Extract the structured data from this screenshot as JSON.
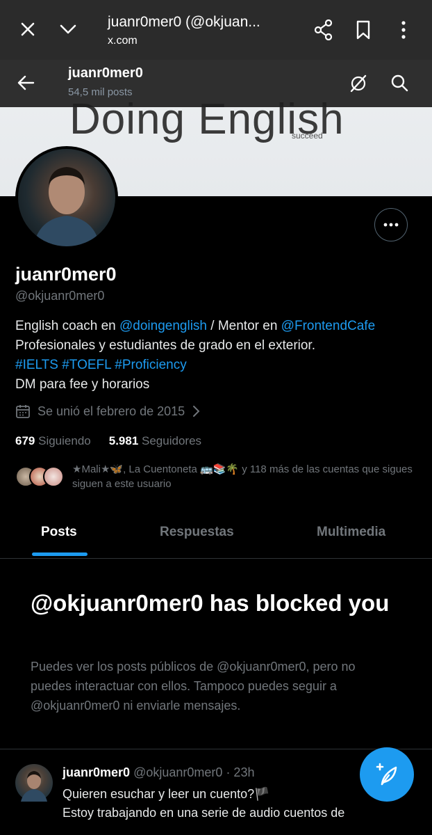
{
  "browser": {
    "title": "juanr0mer0 (@okjuan...",
    "url": "x.com",
    "icons": [
      "close-icon",
      "chevron-down-icon",
      "share-icon",
      "bookmark-icon",
      "more-vert-icon"
    ]
  },
  "banner": {
    "text": "Doing English",
    "subtext": "succeed"
  },
  "topbar": {
    "name": "juanr0mer0",
    "post_count": "54,5 mil posts"
  },
  "profile": {
    "name": "juanr0mer0",
    "handle": "@okjuanr0mer0",
    "bio": {
      "l1a": "English coach en ",
      "l1b": "@doingenglish",
      "l1c": " / Mentor en ",
      "l1d": "@FrontendCafe",
      "l2": "Profesionales y estudiantes de grado en el exterior.",
      "l3": "#IELTS #TOEFL #Proficiency",
      "l4": "DM para fee y horarios"
    },
    "joined": "Se unió el febrero de 2015",
    "following_count": "679",
    "following_label": "Siguiendo",
    "followers_count": "5.981",
    "followers_label": "Seguidores",
    "known_followers": "★Mali★🦋, La Cuentoneta 🚌📚🌴 y 118 más de las cuentas que sigues siguen a este usuario"
  },
  "tabs": [
    "Posts",
    "Respuestas",
    "Multimedia"
  ],
  "blocked": {
    "title": "@okjuanr0mer0 has blocked you",
    "description": "Puedes ver los posts públicos de @okjuanr0mer0, pero no puedes interactuar con ellos. Tampoco puedes seguir a @okjuanr0mer0 ni enviarle mensajes."
  },
  "tweet": {
    "name": "juanr0mer0",
    "handle": "@okjuanr0mer0",
    "time": "· 23h",
    "line1": "Quieren esuchar y leer un cuento?🏴",
    "line2": "Estoy trabajando en una serie de audio cuentos de"
  },
  "colors": {
    "accent": "#1d9bf0",
    "background": "#000000",
    "muted": "#71767b"
  }
}
